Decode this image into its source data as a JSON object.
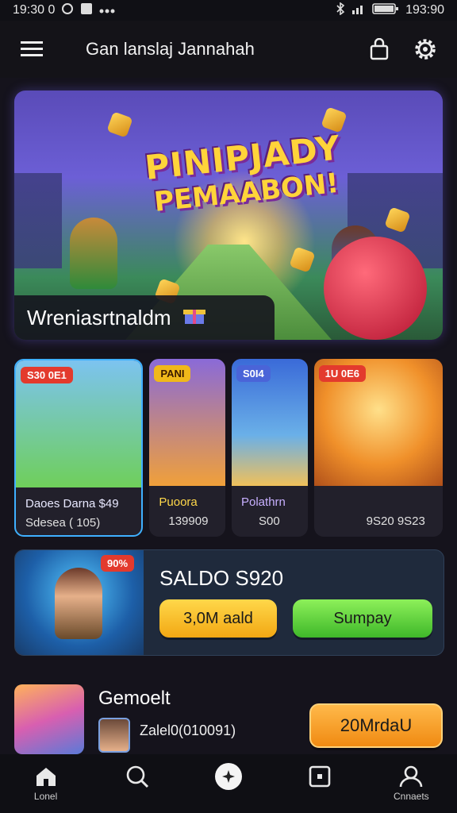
{
  "status_bar": {
    "time_left": "19:30 0",
    "time_right": "193:90"
  },
  "header": {
    "title": "Gan lanslaj Jannahah"
  },
  "hero": {
    "title_line1": "PINIPJADY",
    "title_line2": "PEMAABON!",
    "caption": "Wreniasrtnaldm"
  },
  "cards": [
    {
      "badge": "S30 0E1",
      "line1": "Daoes Darna $49",
      "line2": "Sdesea ( 105)",
      "badge_color": "#e33a2d"
    },
    {
      "badge": "PANI",
      "line1": "Puoora",
      "line2": "139909",
      "badge_color": "#f0b81a"
    },
    {
      "badge": "S0I4",
      "line1": "Polathrn",
      "line2": "S00",
      "badge_color": "#4a64d8"
    },
    {
      "badge": "1U 0E6",
      "line1": "",
      "line2": "9S20 9S23",
      "badge_color": "#e33a2d"
    }
  ],
  "saldo": {
    "badge": "90%",
    "title": "SALDO S920",
    "button_yellow": "3,0M aald",
    "button_green": "Sumpay"
  },
  "game": {
    "title": "Gemoelt",
    "detail": "Zalel0(010091)",
    "button": "20MrdaU"
  },
  "nav": [
    {
      "icon": "home-icon",
      "label": "Lonel"
    },
    {
      "icon": "search-icon",
      "label": ""
    },
    {
      "icon": "center-action-icon",
      "label": ""
    },
    {
      "icon": "square-icon",
      "label": ""
    },
    {
      "icon": "profile-icon",
      "label": "Cnnaets"
    }
  ],
  "colors": {
    "accent_yellow": "#ffd84a",
    "accent_green": "#8df05a",
    "accent_orange": "#f08a12",
    "badge_red": "#e33a2d"
  }
}
